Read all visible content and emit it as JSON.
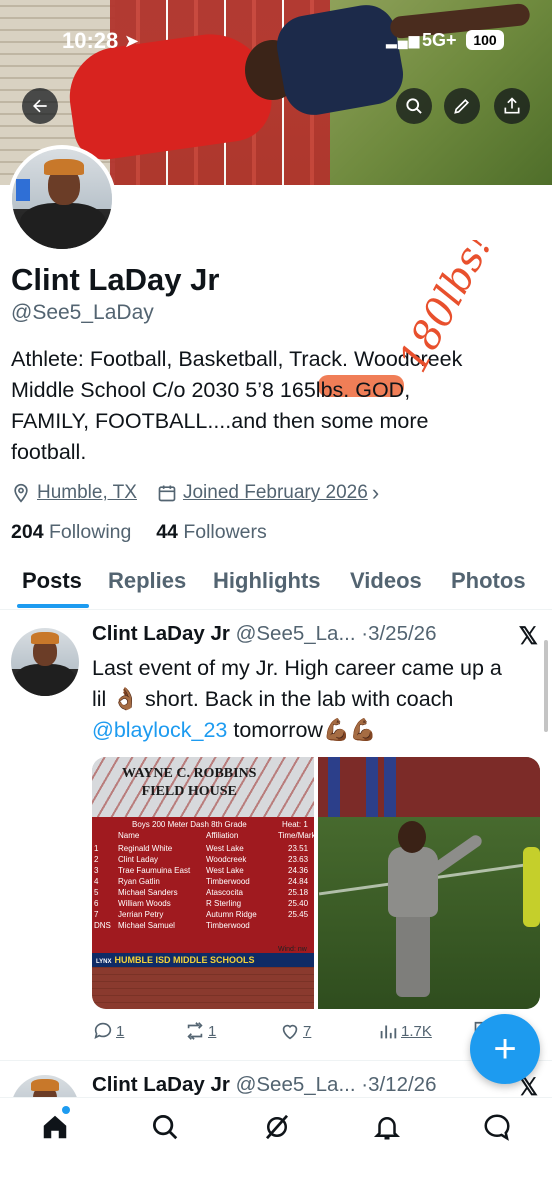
{
  "status_bar": {
    "time": "10:28",
    "network": "5G+",
    "battery": "100"
  },
  "banner": {
    "colors": {
      "track": "#b2342c",
      "grass": "#6f8a3e"
    }
  },
  "header_buttons": [
    "back-icon",
    "search-icon",
    "edit-icon",
    "share-icon"
  ],
  "profile": {
    "name": "Clint LaDay Jr",
    "handle": "@See5_LaDay",
    "bio_line1": "Athlete: Football, Basketball, Track. Woodcreek",
    "bio_line2": "Middle School C/o 2030 5’8 165lbs. GOD,",
    "bio_line3": "FAMILY, FOOTBALL....and then some more",
    "bio_line4": "football.",
    "annotation": "180lbs!",
    "location": "Humble, TX",
    "joined": "Joined February 2026",
    "following_count": "204",
    "following_label": "Following",
    "followers_count": "44",
    "followers_label": "Followers"
  },
  "tabs": [
    {
      "label": "Posts"
    },
    {
      "label": "Replies"
    },
    {
      "label": "Highlights"
    },
    {
      "label": "Videos"
    },
    {
      "label": "Photos"
    }
  ],
  "tweets": [
    {
      "name": "Clint LaDay Jr",
      "handle": "@See5_La...",
      "date": "·3/25/26",
      "text_line1": "Last event of my Jr. High career came up a",
      "text_line2": "lil 👌🏾 short. Back in the lab with coach",
      "mention": "@blaylock_23",
      "text_line3_rest": " tomorrow💪🏾💪🏾",
      "image_left": {
        "title_line1": "WAYNE C. ROBBINS",
        "title_line2": "FIELD HOUSE",
        "event": "Boys 200 Meter Dash 8th Grade",
        "heat": "Heat: 1",
        "col_name": "Name",
        "col_affil": "Affiliation",
        "col_time": "Time/Mark",
        "rows": [
          {
            "place": "1",
            "name": "Reginald White",
            "affil": "West Lake",
            "time": "23.51"
          },
          {
            "place": "2",
            "name": "Clint Laday",
            "affil": "Woodcreek",
            "time": "23.63"
          },
          {
            "place": "3",
            "name": "Trae Faumuina East",
            "affil": "West Lake",
            "time": "24.36"
          },
          {
            "place": "4",
            "name": "Ryan Gatlin",
            "affil": "Timberwood",
            "time": "24.84"
          },
          {
            "place": "5",
            "name": "Michael Sanders",
            "affil": "Atascocita",
            "time": "25.18"
          },
          {
            "place": "6",
            "name": "William Woods",
            "affil": "R Sterling",
            "time": "25.40"
          },
          {
            "place": "7",
            "name": "Jerrian Petry",
            "affil": "Autumn Ridge",
            "time": "25.45"
          },
          {
            "place": "DNS",
            "name": "Michael Samuel",
            "affil": "Timberwood",
            "time": ""
          }
        ],
        "wind": "Wind: nw",
        "footer_brand": "LYNX",
        "footer": "HUMBLE ISD MIDDLE SCHOOLS"
      },
      "replies": "1",
      "reposts": "1",
      "likes": "7",
      "views": "1.7K"
    },
    {
      "name": "Clint LaDay Jr",
      "handle": "@See5_La...",
      "date": "·3/12/26"
    }
  ],
  "bottom_nav": [
    "home-icon",
    "search-icon",
    "grok-icon",
    "notifications-icon",
    "messages-icon"
  ],
  "fab_label": "+"
}
